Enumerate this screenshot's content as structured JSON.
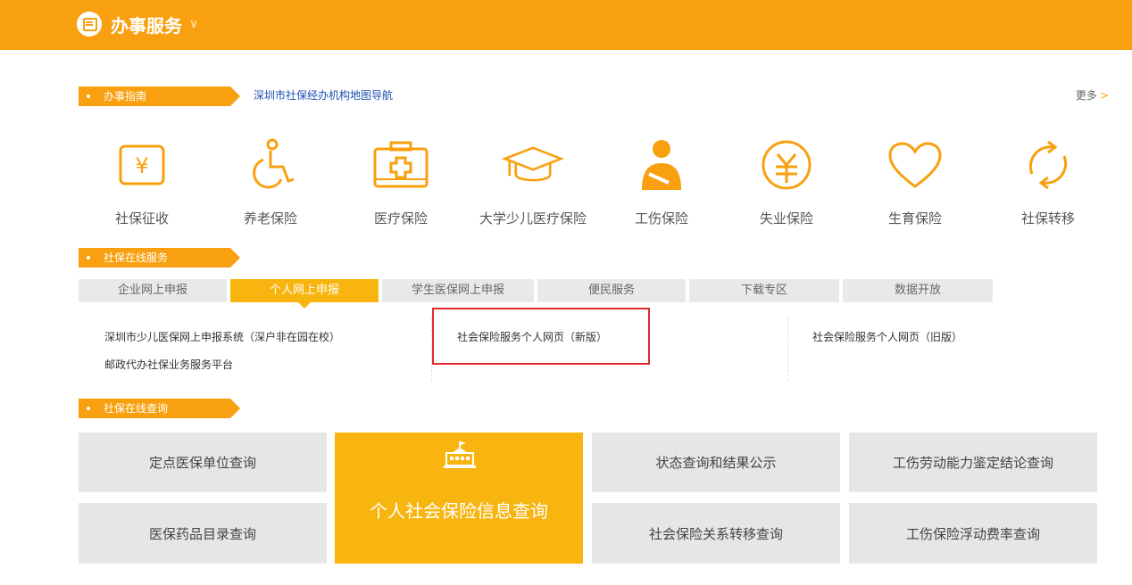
{
  "header": {
    "title": "办事服务"
  },
  "guide": {
    "tag": "办事指南",
    "link": "深圳市社保经办机构地图导航",
    "more": "更多"
  },
  "icons": [
    {
      "label": "社保征收",
      "icon": "yen-box-icon"
    },
    {
      "label": "养老保险",
      "icon": "wheelchair-icon"
    },
    {
      "label": "医疗保险",
      "icon": "medical-kit-icon"
    },
    {
      "label": "大学少儿医疗保险",
      "icon": "graduation-cap-icon"
    },
    {
      "label": "工伤保险",
      "icon": "injured-worker-icon"
    },
    {
      "label": "失业保险",
      "icon": "yuan-circle-icon"
    },
    {
      "label": "生育保险",
      "icon": "heart-icon"
    },
    {
      "label": "社保转移",
      "icon": "refresh-arrows-icon"
    }
  ],
  "online_service": {
    "tag": "社保在线服务",
    "tabs": [
      "企业网上申报",
      "个人网上申报",
      "学生医保网上申报",
      "便民服务",
      "下载专区",
      "数据开放"
    ],
    "active_tab": "个人网上申报",
    "links": [
      "深圳市少儿医保网上申报系统（深户非在园在校）",
      "邮政代办社保业务服务平台",
      "社会保险服务个人网页（新版）",
      "社会保险服务个人网页（旧版）"
    ]
  },
  "online_query": {
    "tag": "社保在线查询",
    "cells": {
      "designated": "定点医保单位查询",
      "drug_catalog": "医保药品目录查询",
      "personal_info": "个人社会保险信息查询",
      "status": "状态查询和结果公示",
      "transfer": "社会保险关系转移查询",
      "work_ability": "工伤劳动能力鉴定结论查询",
      "float_rate": "工伤保险浮动费率查询"
    }
  },
  "colors": {
    "accent": "#f8a00f",
    "accent_light": "#f8b50f",
    "highlight": "#e12a2a",
    "link": "#1a4fb0"
  }
}
